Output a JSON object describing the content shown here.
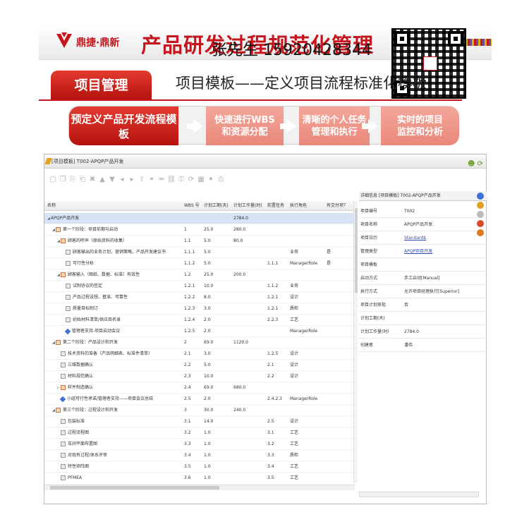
{
  "banner": {
    "logo_text": "鼎捷·鼎新",
    "title": "产品研发过程规范化管理",
    "contact": "张先生 15920428344"
  },
  "subheader": {
    "tab_label": "项目管理",
    "title": "项目模板——定义项目流程标准化模板"
  },
  "flow": {
    "steps": [
      "预定义产品开发流程模板",
      "快速进行WBS\n和资源分配",
      "清晰的个人任务\n管理和执行",
      "实时的项目\n监控和分析"
    ]
  },
  "window": {
    "title": "[项目模板] T002-APQP产品开发"
  },
  "toolbar": {
    "icons": [
      "new-icon",
      "copy-icon",
      "paste-icon",
      "paste-special-icon",
      "delete-icon",
      "move-up-icon",
      "move-down-icon",
      "indent-icon",
      "outdent-icon",
      "export-icon",
      "link-icon",
      "unlink-icon",
      "chain-icon",
      "lock-icon",
      "refresh-icon",
      "calendar-icon",
      "highlight-icon",
      "print-icon"
    ]
  },
  "grid": {
    "columns": [
      "名称",
      "WBS 号",
      "计划工期(天)",
      "计划工作量(时)",
      "前置任务",
      "执行角色",
      "有交付项？"
    ],
    "rows": [
      {
        "level": 0,
        "type": "root",
        "name": "APQP产品开发",
        "wbs": "",
        "dur": "",
        "work": "2784.0",
        "pred": "",
        "role": "",
        "deliv": "",
        "selected": true
      },
      {
        "level": 1,
        "type": "summary",
        "name": "第一个阶段：项目前期与启动",
        "wbs": "1",
        "dur": "25.0",
        "work": "280.0",
        "pred": "",
        "role": "",
        "deliv": ""
      },
      {
        "level": 2,
        "type": "summary",
        "name": "顾客的呼声（原始资料的收集）",
        "wbs": "1.1",
        "dur": "5.0",
        "work": "80.0",
        "pred": "",
        "role": "",
        "deliv": ""
      },
      {
        "level": 3,
        "type": "task",
        "name": "顾客输出的业务计划，营销策略，产品开发建议书",
        "wbs": "1.1.1",
        "dur": "5.0",
        "work": "",
        "pred": "",
        "role": "业务",
        "deliv": "是"
      },
      {
        "level": 3,
        "type": "task",
        "name": "可行性分析",
        "wbs": "1.1.2",
        "dur": "5.0",
        "work": "",
        "pred": "1.1.1",
        "role": "ManagerRole",
        "deliv": "是"
      },
      {
        "level": 2,
        "type": "summary",
        "name": "顾客输入（图纸、数据、标准）有效性",
        "wbs": "1.2",
        "dur": "25.0",
        "work": "200.0",
        "pred": "",
        "role": "",
        "deliv": ""
      },
      {
        "level": 3,
        "type": "task",
        "name": "试制协议的签定",
        "wbs": "1.2.1",
        "dur": "10.0",
        "work": "",
        "pred": "1.1.2",
        "role": "业务",
        "deliv": ""
      },
      {
        "level": 3,
        "type": "task",
        "name": "产品过程设想、基准、可靠性",
        "wbs": "1.2.2",
        "dur": "8.0",
        "work": "",
        "pred": "1.2.1",
        "role": "设计",
        "deliv": ""
      },
      {
        "level": 3,
        "type": "task",
        "name": "质量目标制订",
        "wbs": "1.2.3",
        "dur": "3.0",
        "work": "",
        "pred": "1.2.1",
        "role": "质检",
        "deliv": ""
      },
      {
        "level": 3,
        "type": "task",
        "name": "初始材料清单/供应商名录",
        "wbs": "1.2.4",
        "dur": "2.0",
        "work": "",
        "pred": "2.2.3",
        "role": "工艺",
        "deliv": ""
      },
      {
        "level": 3,
        "type": "milestone",
        "name": "管理者支持-项目启动会议",
        "wbs": "1.2.5",
        "dur": "2.0",
        "work": "",
        "pred": "",
        "role": "ManagerRole",
        "deliv": ""
      },
      {
        "level": 1,
        "type": "summary",
        "name": "第二个阶段：产品设计和开发",
        "wbs": "2",
        "dur": "69.0",
        "work": "1120.0",
        "pred": "",
        "role": "",
        "deliv": ""
      },
      {
        "level": 2,
        "type": "task",
        "name": "技术资料的准备（产品明细表、标准件清单）",
        "wbs": "2.1",
        "dur": "3.0",
        "work": "",
        "pred": "1.2.5",
        "role": "设计",
        "deliv": ""
      },
      {
        "level": 2,
        "type": "task",
        "name": "三维数据确认",
        "wbs": "2.2",
        "dur": "5.0",
        "work": "",
        "pred": "2.1",
        "role": "设计",
        "deliv": ""
      },
      {
        "level": 2,
        "type": "task",
        "name": "材料规范确认",
        "wbs": "2.3",
        "dur": "10.0",
        "work": "",
        "pred": "2.2",
        "role": "设计",
        "deliv": ""
      },
      {
        "level": 2,
        "type": "summary-collapsed",
        "name": "样件制造确认",
        "wbs": "2.4",
        "dur": "69.0",
        "work": "680.0",
        "pred": "",
        "role": "",
        "deliv": ""
      },
      {
        "level": 2,
        "type": "milestone",
        "name": "小组可行性承诺/管理者支持——项目会议总结",
        "wbs": "2.5",
        "dur": "2.0",
        "work": "",
        "pred": "2.4.2.3",
        "role": "ManagerRole",
        "deliv": ""
      },
      {
        "level": 1,
        "type": "summary",
        "name": "第三个阶段：过程设计和开发",
        "wbs": "3",
        "dur": "30.0",
        "work": "240.0",
        "pred": "",
        "role": "",
        "deliv": ""
      },
      {
        "level": 2,
        "type": "task",
        "name": "包装标准",
        "wbs": "3.1",
        "dur": "14.0",
        "work": "",
        "pred": "2.5",
        "role": "设计",
        "deliv": ""
      },
      {
        "level": 2,
        "type": "task",
        "name": "过程流程图",
        "wbs": "3.2",
        "dur": "1.0",
        "work": "",
        "pred": "3.1",
        "role": "工艺",
        "deliv": ""
      },
      {
        "level": 2,
        "type": "task",
        "name": "车间平面布置图",
        "wbs": "3.3",
        "dur": "1.0",
        "work": "",
        "pred": "3.2",
        "role": "工艺",
        "deliv": ""
      },
      {
        "level": 2,
        "type": "task",
        "name": "对现有过程/体系评审",
        "wbs": "3.4",
        "dur": "1.0",
        "work": "",
        "pred": "3.3",
        "role": "质检",
        "deliv": ""
      },
      {
        "level": 2,
        "type": "task",
        "name": "特性矩阵图",
        "wbs": "3.5",
        "dur": "1.0",
        "work": "",
        "pred": "3.4",
        "role": "工艺",
        "deliv": ""
      },
      {
        "level": 2,
        "type": "task",
        "name": "PFMEA",
        "wbs": "3.6",
        "dur": "1.0",
        "work": "",
        "pred": "3.5",
        "role": "工艺",
        "deliv": ""
      }
    ]
  },
  "details": {
    "header": "详细信息   [项目模板] T002-APQP产品开发",
    "fields": [
      {
        "label": "项目编号",
        "value": "T002",
        "link": false
      },
      {
        "label": "项目名称",
        "value": "APQP产品开发",
        "link": false
      },
      {
        "label": "项目日历",
        "value": "Standard$",
        "link": true
      },
      {
        "label": "管理类型",
        "value": "APQP项目开发",
        "link": true
      },
      {
        "label": "项目模板",
        "value": "",
        "link": false
      },
      {
        "label": "启动方式",
        "value": "手工启动[Manual]",
        "link": false
      },
      {
        "label": "执行方式",
        "value": "允许项目经理执行[Superior]",
        "link": false
      },
      {
        "label": "项目计划审批",
        "value": "否",
        "link": false
      },
      {
        "label": "计划工期(天)",
        "value": "",
        "link": false
      },
      {
        "label": "计划工作量(时)",
        "value": "2784.0",
        "link": false
      },
      {
        "label": "创建者",
        "value": "潘伟",
        "link": false
      }
    ]
  },
  "colors": {
    "brand_red": "#c4161c",
    "selection_blue": "#d5e3f5",
    "link_blue": "#2f4fb0"
  }
}
